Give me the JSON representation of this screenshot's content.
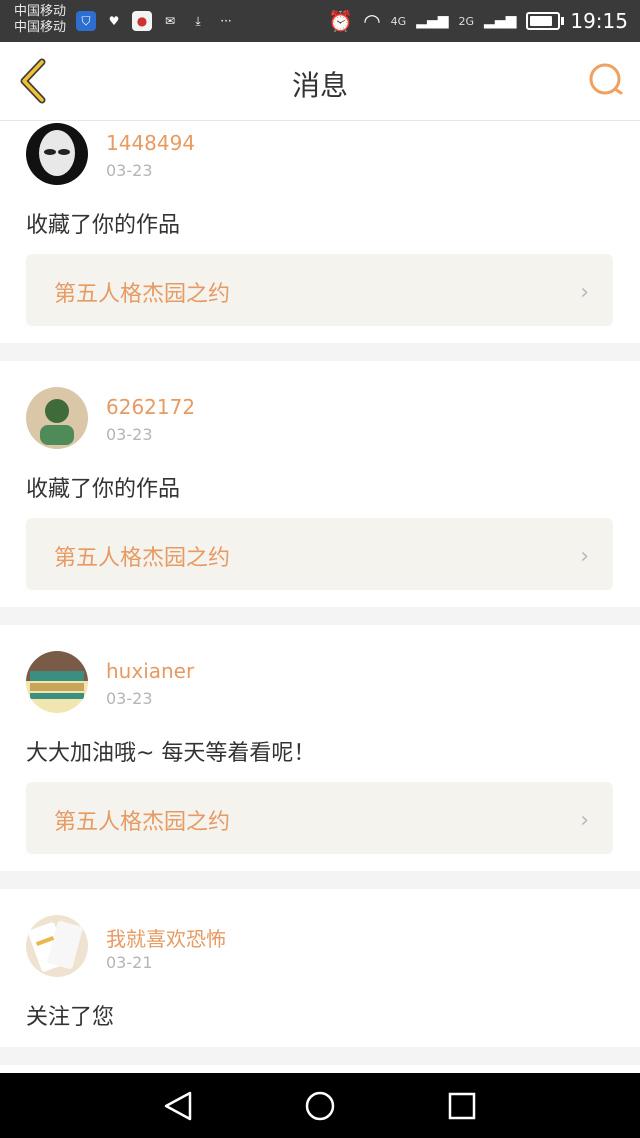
{
  "status_bar": {
    "carrier_1": "中国移动",
    "carrier_2": "中国移动",
    "network_1": "4G",
    "network_2": "2G",
    "time": "19:15",
    "more": "···"
  },
  "header": {
    "title": "消息"
  },
  "messages": [
    {
      "username": "1448494",
      "date": "03-23",
      "text": "收藏了你的作品",
      "work_title": "第五人格杰园之约"
    },
    {
      "username": "6262172",
      "date": "03-23",
      "text": "收藏了你的作品",
      "work_title": "第五人格杰园之约"
    },
    {
      "username": "huxianer",
      "date": "03-23",
      "text": "大大加油哦~ 每天等着看呢！",
      "work_title": "第五人格杰园之约"
    },
    {
      "username": "我就喜欢恐怖",
      "date": "03-21",
      "text": "关注了您"
    }
  ],
  "colors": {
    "accent": "#e79a62",
    "back_arrow": "#f2c230",
    "card_bg": "#ffffff",
    "page_bg": "#f4f4f4",
    "work_bg": "#f4f3ee"
  },
  "icons": {
    "back": "back-arrow-icon",
    "search": "search-icon",
    "chevron": "chevron-right-icon",
    "nav_back": "nav-back-icon",
    "nav_home": "nav-home-icon",
    "nav_recents": "nav-recents-icon"
  }
}
